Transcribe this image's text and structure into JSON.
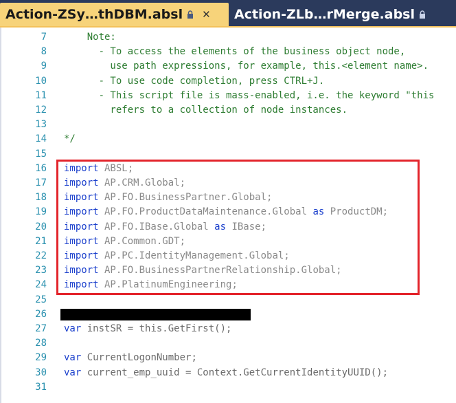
{
  "tabs": [
    {
      "label": "Action-ZSy…thDBM.absl",
      "active": true,
      "has_close": true
    },
    {
      "label": "Action-ZLb…rMerge.absl",
      "active": false,
      "has_close": false
    }
  ],
  "editor": {
    "lines": [
      {
        "n": "7",
        "parts": [
          {
            "t": "    Note:",
            "c": "comment"
          }
        ]
      },
      {
        "n": "8",
        "parts": [
          {
            "t": "      - To access the elements of the business object node,",
            "c": "comment"
          }
        ]
      },
      {
        "n": "9",
        "parts": [
          {
            "t": "        use path expressions, for example, this.<element name>.",
            "c": "comment"
          }
        ]
      },
      {
        "n": "10",
        "parts": [
          {
            "t": "      - To use code completion, press CTRL+J.",
            "c": "comment"
          }
        ]
      },
      {
        "n": "11",
        "parts": [
          {
            "t": "      - This script file is mass-enabled, i.e. the keyword \"this",
            "c": "comment"
          }
        ]
      },
      {
        "n": "12",
        "parts": [
          {
            "t": "        refers to a collection of node instances.",
            "c": "comment"
          }
        ]
      },
      {
        "n": "13",
        "parts": []
      },
      {
        "n": "14",
        "parts": [
          {
            "t": "*/",
            "c": "comment"
          }
        ]
      },
      {
        "n": "15",
        "parts": []
      },
      {
        "n": "16",
        "parts": [
          {
            "t": "import",
            "c": "kw"
          },
          {
            "t": " ABSL;",
            "c": "ns"
          }
        ]
      },
      {
        "n": "17",
        "parts": [
          {
            "t": "import",
            "c": "kw"
          },
          {
            "t": " AP.CRM.Global;",
            "c": "ns"
          }
        ]
      },
      {
        "n": "18",
        "parts": [
          {
            "t": "import",
            "c": "kw"
          },
          {
            "t": " AP.FO.BusinessPartner.Global;",
            "c": "ns"
          }
        ]
      },
      {
        "n": "19",
        "parts": [
          {
            "t": "import",
            "c": "kw"
          },
          {
            "t": " AP.FO.ProductDataMaintenance.Global ",
            "c": "ns"
          },
          {
            "t": "as",
            "c": "kw"
          },
          {
            "t": " ProductDM;",
            "c": "ns"
          }
        ]
      },
      {
        "n": "20",
        "parts": [
          {
            "t": "import",
            "c": "kw"
          },
          {
            "t": " AP.FO.IBase.Global ",
            "c": "ns"
          },
          {
            "t": "as",
            "c": "kw"
          },
          {
            "t": " IBase;",
            "c": "ns"
          }
        ]
      },
      {
        "n": "21",
        "parts": [
          {
            "t": "import",
            "c": "kw"
          },
          {
            "t": " AP.Common.GDT;",
            "c": "ns"
          }
        ]
      },
      {
        "n": "22",
        "parts": [
          {
            "t": "import",
            "c": "kw"
          },
          {
            "t": " AP.PC.IdentityManagement.Global;",
            "c": "ns"
          }
        ]
      },
      {
        "n": "23",
        "parts": [
          {
            "t": "import",
            "c": "kw"
          },
          {
            "t": " AP.FO.BusinessPartnerRelationship.Global;",
            "c": "ns"
          }
        ]
      },
      {
        "n": "24",
        "parts": [
          {
            "t": "import",
            "c": "kw"
          },
          {
            "t": " AP.PlatinumEngineering;",
            "c": "ns"
          }
        ]
      },
      {
        "n": "25",
        "parts": []
      },
      {
        "n": "26",
        "parts": []
      },
      {
        "n": "27",
        "parts": [
          {
            "t": "var",
            "c": "kw"
          },
          {
            "t": " instSR = this.",
            "c": "fn"
          },
          {
            "t": "GetFirst();",
            "c": "fn"
          }
        ]
      },
      {
        "n": "28",
        "parts": []
      },
      {
        "n": "29",
        "parts": [
          {
            "t": "var",
            "c": "kw"
          },
          {
            "t": " CurrentLogonNumber;",
            "c": "fn"
          }
        ]
      },
      {
        "n": "30",
        "parts": [
          {
            "t": "var",
            "c": "kw"
          },
          {
            "t": " current_emp_uuid = Context.GetCurrentIdentityUUID();",
            "c": "fn"
          }
        ]
      },
      {
        "n": "31",
        "parts": []
      }
    ]
  }
}
